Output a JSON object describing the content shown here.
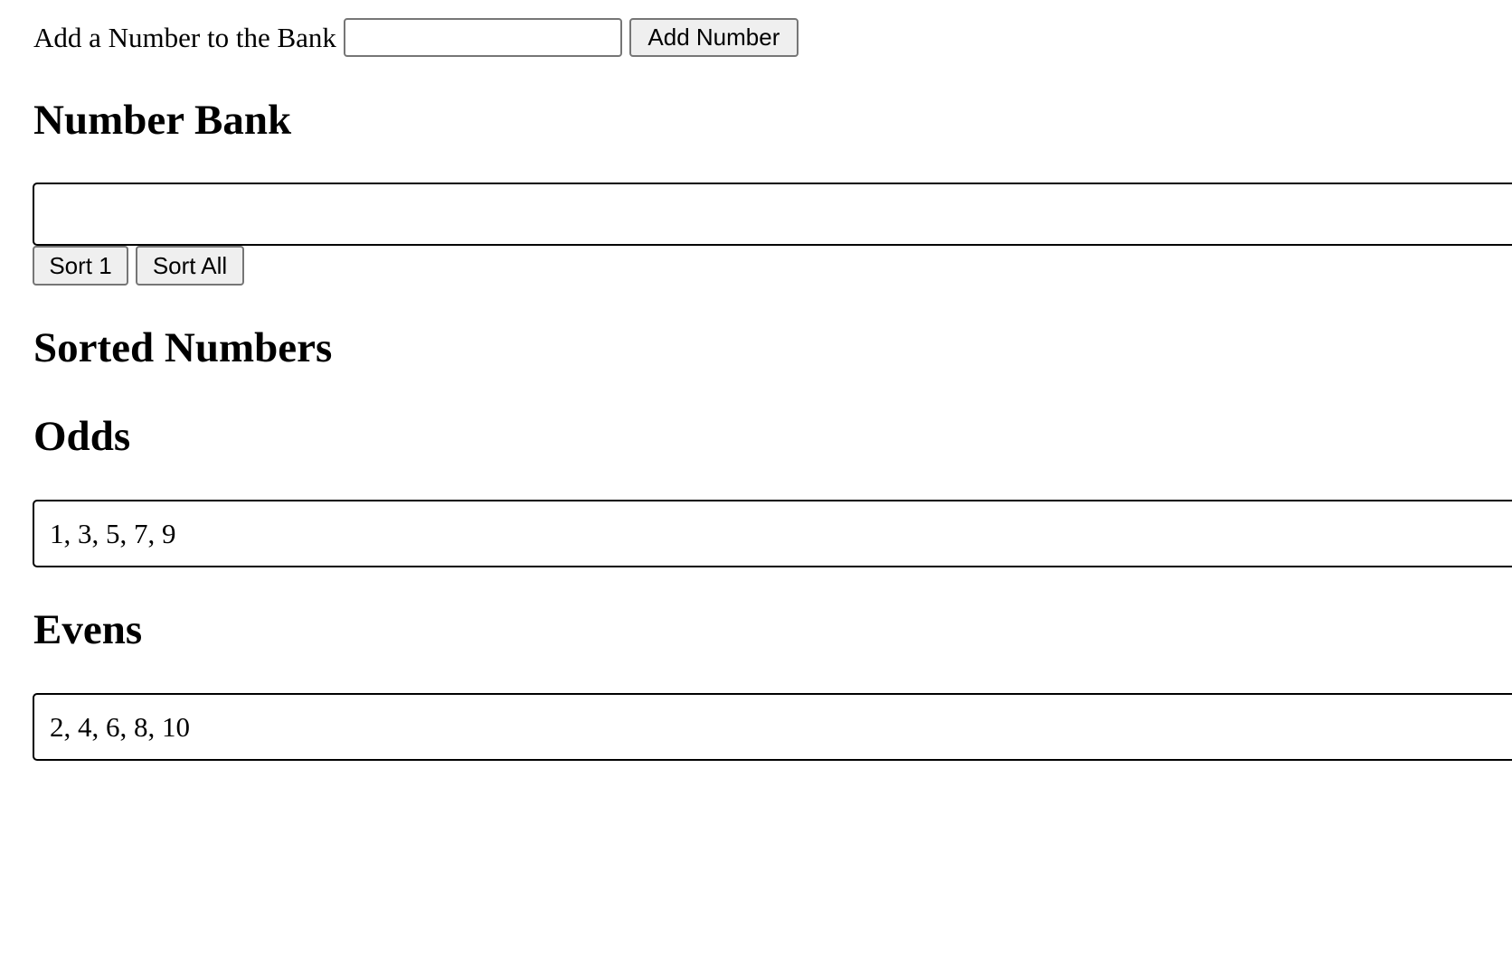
{
  "add_form": {
    "label": "Add a Number to the Bank",
    "input_value": "",
    "button_label": "Add Number"
  },
  "number_bank": {
    "heading": "Number Bank",
    "contents": "",
    "sort_one_label": "Sort 1",
    "sort_all_label": "Sort All"
  },
  "sorted": {
    "heading": "Sorted Numbers",
    "odds": {
      "heading": "Odds",
      "values": "1, 3, 5, 7, 9"
    },
    "evens": {
      "heading": "Evens",
      "values": "2, 4, 6, 8, 10"
    }
  }
}
